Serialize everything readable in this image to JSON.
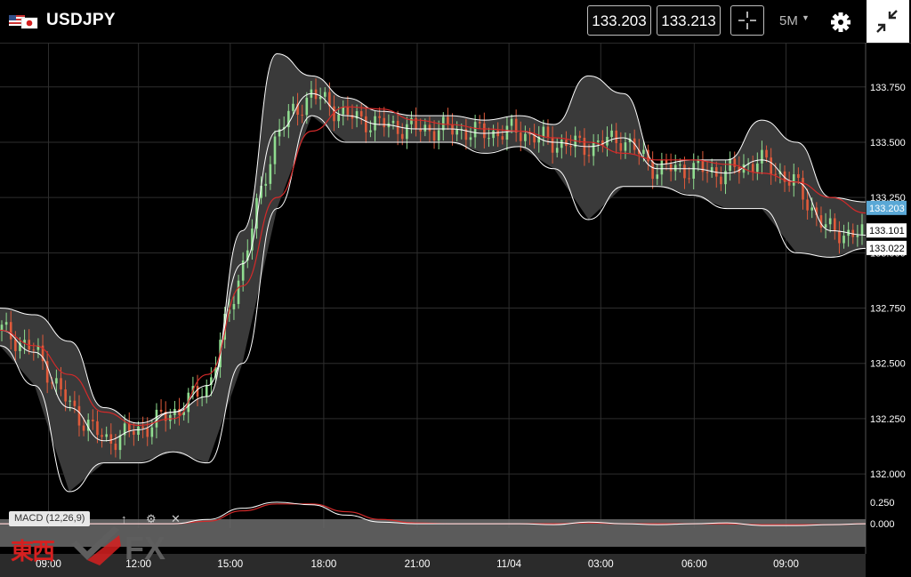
{
  "header": {
    "symbol": "USDJPY",
    "bid": "133.203",
    "ask": "133.213",
    "timeframe": "5M",
    "icons": [
      "us-flag-icon",
      "jp-flag-icon",
      "crosshair-icon",
      "chevron-down-icon",
      "gear-icon",
      "collapse-icon"
    ]
  },
  "indicator": {
    "label": "MACD (12,26,9)",
    "icons": [
      "arrow-up-icon",
      "gear-icon",
      "close-icon"
    ]
  },
  "watermark": {
    "kanji": "東西",
    "fx": "FX"
  },
  "colors": {
    "background": "#000000",
    "band_fill": "#3a3a3a",
    "band_line": "#ffffff",
    "ma_line": "#d42a2a",
    "bullish": "#8fdc8f",
    "bearish": "#e05a3a",
    "price_tag": "#5aa8d6",
    "macd_panel": "#6b6b6b"
  },
  "chart_data": {
    "type": "line",
    "title": "",
    "symbol": "USDJPY",
    "timeframe": "5M",
    "x_ticks": [
      "09:00",
      "12:00",
      "15:00",
      "18:00",
      "21:00",
      "11/04",
      "03:00",
      "06:00",
      "09:00"
    ],
    "y_ticks": [
      "133.750",
      "133.500",
      "133.250",
      "133.000",
      "132.750",
      "132.500",
      "132.250",
      "132.000"
    ],
    "ylim": [
      131.9,
      133.95
    ],
    "grid": true,
    "price_tags": {
      "current": "133.203",
      "upper": "133.101",
      "lower": "133.022"
    },
    "macd_ticks": [
      "0.250",
      "0.000"
    ],
    "series": [
      {
        "name": "Bollinger upper",
        "values": [
          132.75,
          132.72,
          132.6,
          132.3,
          132.23,
          132.28,
          132.35,
          133.1,
          133.9,
          133.8,
          133.7,
          133.64,
          133.62,
          133.62,
          133.6,
          133.62,
          133.58,
          133.8,
          133.72,
          133.4,
          133.42,
          133.42,
          133.6,
          133.5,
          133.25,
          133.23
        ]
      },
      {
        "name": "Bollinger middle",
        "values": [
          132.65,
          132.55,
          132.3,
          132.15,
          132.2,
          132.28,
          132.4,
          132.95,
          133.55,
          133.72,
          133.62,
          133.58,
          133.56,
          133.56,
          133.54,
          133.55,
          133.5,
          133.48,
          133.52,
          133.38,
          133.38,
          133.36,
          133.42,
          133.32,
          133.1,
          133.08
        ]
      },
      {
        "name": "Bollinger lower",
        "values": [
          132.58,
          132.4,
          131.92,
          132.05,
          132.05,
          132.1,
          132.05,
          132.5,
          133.2,
          133.62,
          133.5,
          133.5,
          133.5,
          133.5,
          133.45,
          133.48,
          133.38,
          133.15,
          133.3,
          133.3,
          133.26,
          133.2,
          133.2,
          133.0,
          132.98,
          133.02
        ]
      },
      {
        "name": "Moving average",
        "values": [
          132.65,
          132.58,
          132.45,
          132.28,
          132.22,
          132.25,
          132.45,
          132.85,
          133.25,
          133.55,
          133.66,
          133.65,
          133.6,
          133.58,
          133.56,
          133.55,
          133.52,
          133.5,
          133.45,
          133.42,
          133.42,
          133.4,
          133.36,
          133.32,
          133.25,
          133.18
        ]
      }
    ],
    "macd": {
      "ylim": [
        -0.05,
        0.3
      ],
      "macd_values": [
        0.0,
        0.0,
        0.0,
        0.0,
        0.0,
        0.0,
        0.05,
        0.18,
        0.25,
        0.22,
        0.1,
        0.02,
        0.0,
        0.0,
        0.0,
        0.0,
        -0.01,
        0.02,
        0.0,
        -0.01,
        0.0,
        0.01,
        -0.02,
        -0.02,
        -0.01,
        0.0
      ],
      "signal_values": [
        0.0,
        0.0,
        0.0,
        0.0,
        0.0,
        0.0,
        0.03,
        0.15,
        0.23,
        0.23,
        0.14,
        0.05,
        0.01,
        0.0,
        0.0,
        0.0,
        0.0,
        0.01,
        0.0,
        0.0,
        0.0,
        0.0,
        -0.01,
        -0.01,
        -0.01,
        0.0
      ]
    }
  }
}
